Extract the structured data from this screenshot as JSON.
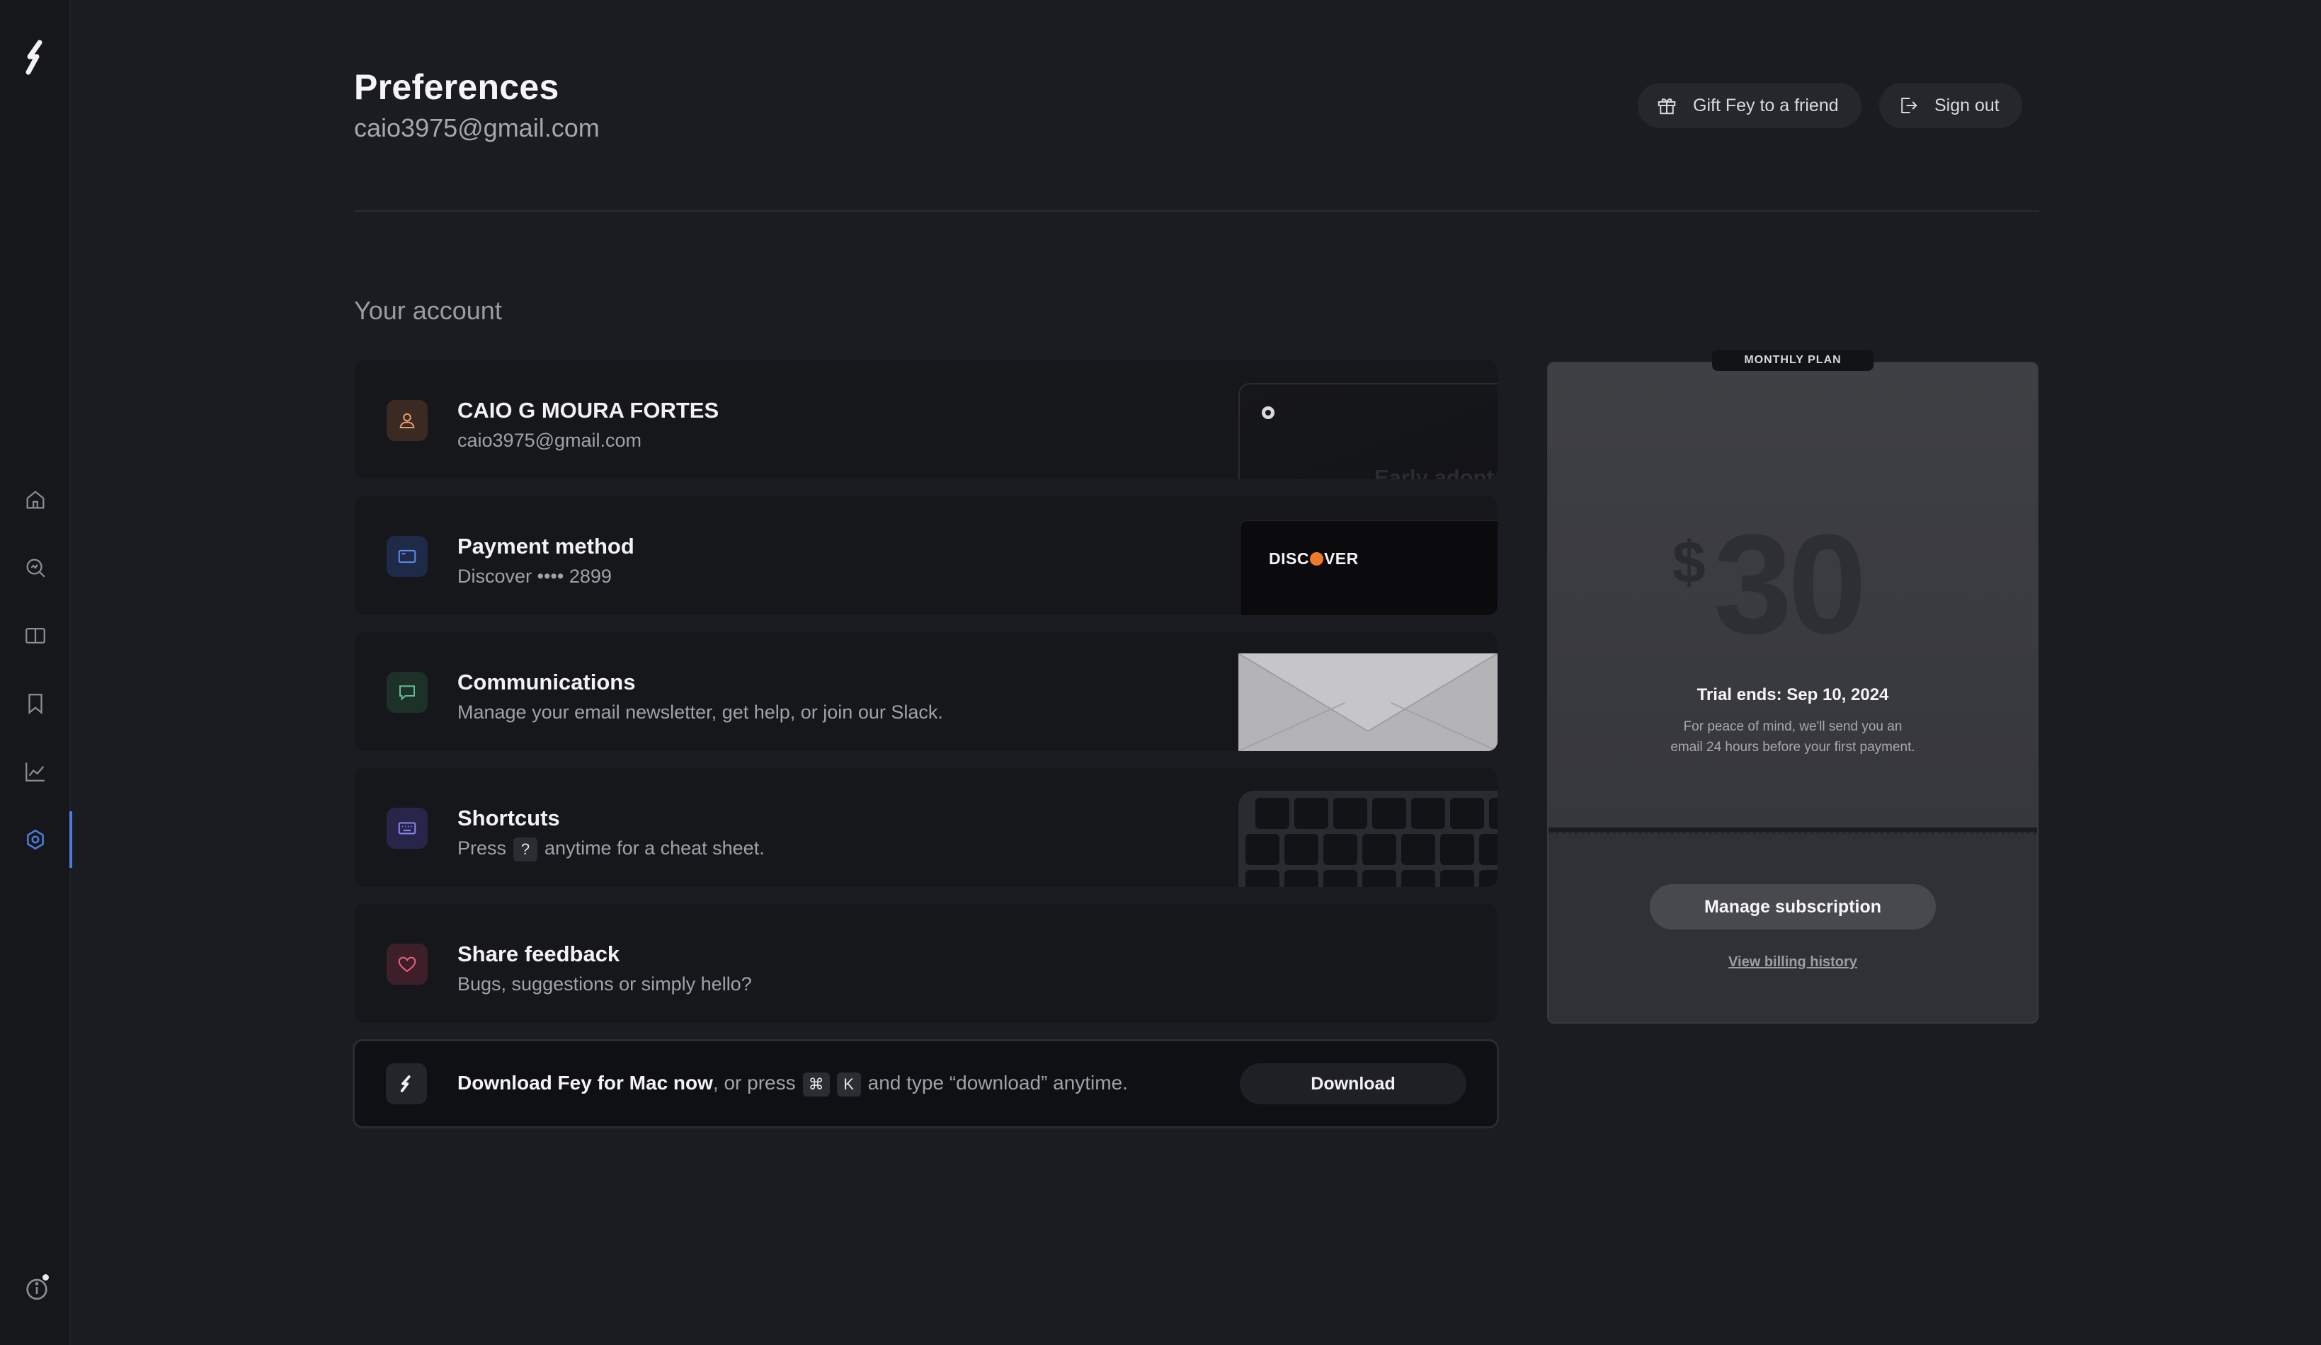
{
  "header": {
    "title": "Preferences",
    "email": "caio3975@gmail.com",
    "gift_label": "Gift Fey to a friend",
    "signout_label": "Sign out"
  },
  "section": {
    "title": "Your account"
  },
  "cards": [
    {
      "title": "CAIO G MOURA FORTES",
      "desc": "caio3975@gmail.com",
      "icon": "user-icon",
      "visual_text": "Early adopter"
    },
    {
      "title": "Payment method",
      "desc": "Discover •••• 2899",
      "icon": "credit-card-icon",
      "visual_text_left": "DISC",
      "visual_text_right": "VER"
    },
    {
      "title": "Communications",
      "desc": "Manage your email newsletter, get help, or join our Slack.",
      "icon": "chat-bubble-icon"
    },
    {
      "title": "Shortcuts",
      "desc_pre": "Press",
      "key": "?",
      "desc_post": "anytime for a cheat sheet.",
      "icon": "keyboard-icon"
    },
    {
      "title": "Share feedback",
      "desc": "Bugs, suggestions or simply hello?",
      "icon": "heart-icon"
    }
  ],
  "download": {
    "bold": "Download Fey for Mac now",
    "text_pre": ", or press",
    "key1": "⌘",
    "key2": "K",
    "text_post": "and type “download” anytime.",
    "button_label": "Download"
  },
  "plan": {
    "tag": "MONTHLY PLAN",
    "currency": "$",
    "amount": "30",
    "trial_title": "Trial ends: Sep 10, 2024",
    "trial_note": "For peace of mind, we'll send you an email 24 hours before your first payment.",
    "manage_label": "Manage subscription",
    "billing_label": "View billing history"
  },
  "sidebar": {
    "items": [
      "home-icon",
      "search-icon",
      "book-icon",
      "bookmark-icon",
      "chart-icon",
      "settings-icon"
    ],
    "active": "settings-icon"
  },
  "colors": {
    "background": "#1b1c21",
    "card": "#16171b",
    "accent": "#4d7bd9",
    "discover_orange": "#ef7a29"
  }
}
